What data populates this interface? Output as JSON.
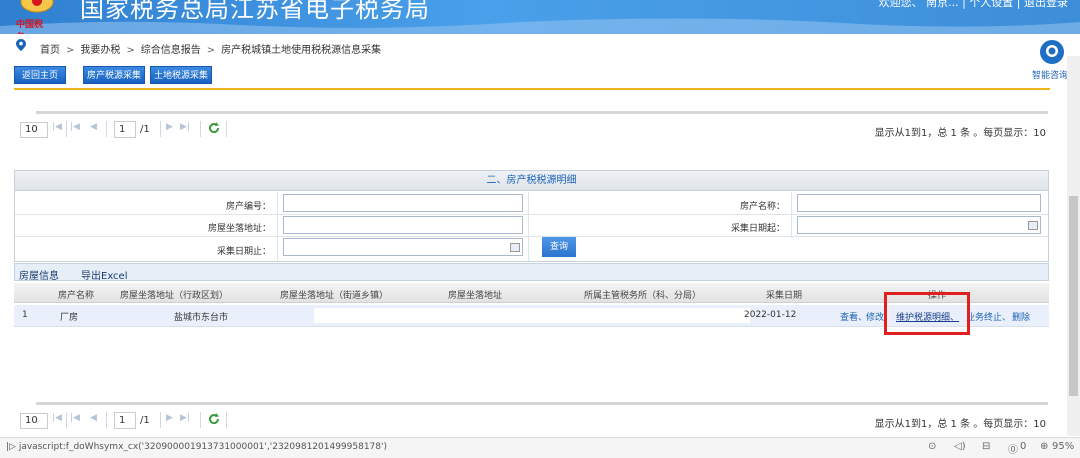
{
  "header": {
    "site_title": "国家税务总局江苏省电子税务局",
    "logo_text": "中国税务",
    "links": "欢迎您、 南京... | 个人设置 | 退出登录"
  },
  "breadcrumb": {
    "items": [
      "首页",
      "我要办税",
      "综合信息报告",
      "房产税城镇土地使用税税源信息采集"
    ],
    "separator": ">"
  },
  "assistant": {
    "label": "智能咨询"
  },
  "actions": {
    "back_home": "返回主页",
    "property_tax_source": "房产税源采集",
    "land_tax_source": "土地税源采集"
  },
  "pager": {
    "page_size": "10",
    "current_page": "1",
    "total_pages": "/1",
    "info": "显示从1到1，总 1 条 。每页显示：10"
  },
  "form": {
    "title": "二、房产税税源明细",
    "property_no_label": "房产编号：",
    "property_name_label": "房产名称：",
    "address_label": "房屋坐落地址：",
    "collect_start_label": "采集日期起：",
    "collect_end_label": "采集日期止：",
    "query_button": "查询"
  },
  "grid": {
    "toolbar": {
      "house_info": "房屋信息",
      "export_excel": "导出Excel"
    },
    "columns": [
      "房产名称",
      "房屋坐落地址（行政区划）",
      "房屋坐落地址（街道乡镇）",
      "房屋坐落地址",
      "所属主管税务所（科、分局）",
      "采集日期",
      "操作"
    ],
    "rows": [
      {
        "index": "1",
        "name": "厂房",
        "district": "盐城市东台市",
        "date": "2022-01-12",
        "ops": {
          "view": "查看、",
          "edit": "修改、",
          "maintain": "维护税源明细、",
          "terminate": "业务终止、",
          "delete": "删除"
        }
      }
    ]
  },
  "status": {
    "url": "javascript:f_doWhsymx_cx('320900001913731000001','2320981201499958178')",
    "zoom": "95%",
    "count": "0"
  },
  "colors": {
    "primary": "#1a62b8",
    "accent": "#f0b31c",
    "highlight": "#e01f1f"
  }
}
